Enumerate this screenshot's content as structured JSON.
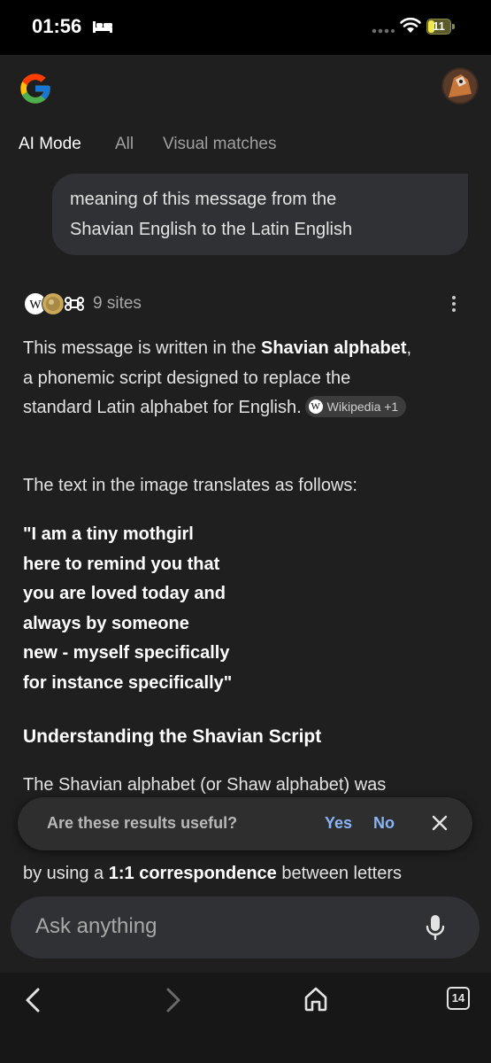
{
  "status_bar": {
    "time": "01:56",
    "battery": "11"
  },
  "header": {
    "logo": "google-g-logo",
    "avatar": "profile-avatar"
  },
  "tabs": [
    {
      "label": "AI Mode",
      "active": true
    },
    {
      "label": "All",
      "active": false
    },
    {
      "label": "Visual matches",
      "active": false
    }
  ],
  "query": {
    "line1": "meaning of this message from the",
    "line2": "Shavian English to the Latin English"
  },
  "sources": {
    "count_label": "9 sites"
  },
  "answer": {
    "p1_a": "This message is written in the ",
    "p1_bold": "Shavian alphabet",
    "p1_b": ", a phonemic script designed to replace the standard Latin alphabet for English.",
    "citation": "Wikipedia +1",
    "p2": "The text in the image translates as follows:",
    "quote_lines": [
      "\"I am a tiny mothgirl",
      "here to remind you that",
      "you are loved today and",
      "always by someone",
      "new - myself specifically",
      "for instance specifically\""
    ],
    "heading": "Understanding the Shavian Script",
    "p3": "The Shavian alphabet (or Shaw alphabet) was",
    "p4_a": "by using a ",
    "p4_bold": "1:1 correspondence",
    "p4_b": " between letters"
  },
  "feedback": {
    "question": "Are these results useful?",
    "yes": "Yes",
    "no": "No"
  },
  "ask": {
    "placeholder": "Ask anything"
  },
  "browser": {
    "tab_count": "14"
  },
  "colors": {
    "background": "#1f1f1f",
    "accent": "#8ab4f8",
    "bubble": "#303134"
  }
}
